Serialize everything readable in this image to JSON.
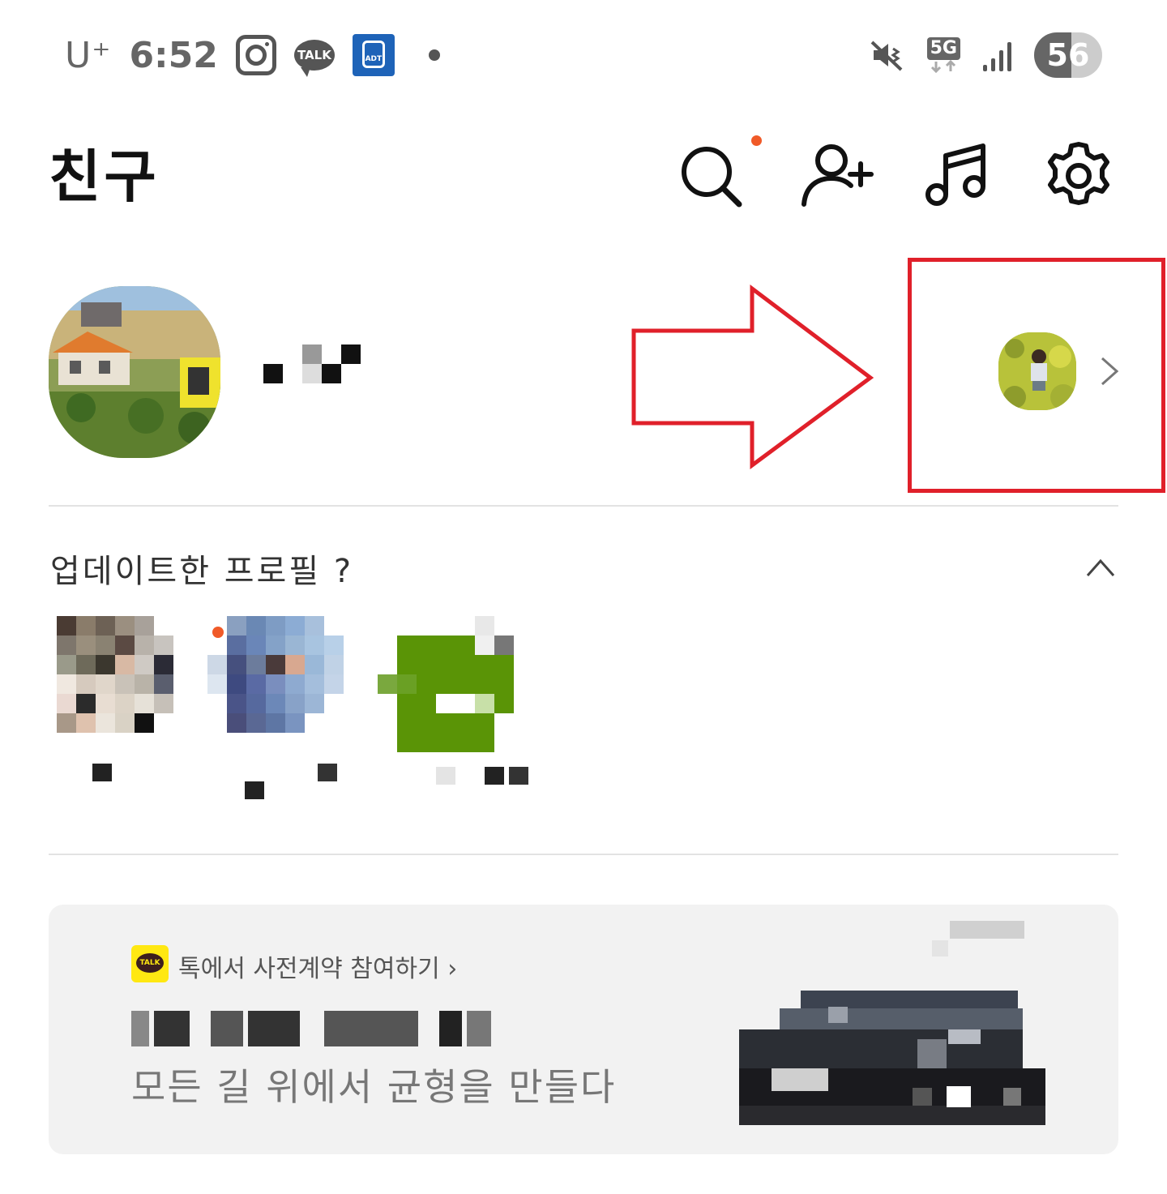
{
  "status_bar": {
    "carrier": "U⁺",
    "time": "6:52",
    "icons_left": [
      "instagram-icon",
      "kakaotalk-icon",
      "adt-icon",
      "notification-dot"
    ],
    "talk_label": "TALK",
    "adt_label": "ADT",
    "icons_right": [
      "mute-vibrate-icon",
      "5g-icon",
      "signal-icon",
      "battery-icon"
    ],
    "network": "5G",
    "battery": "56"
  },
  "header": {
    "title": "친구",
    "actions": [
      "search-icon",
      "add-friend-icon",
      "music-icon",
      "settings-icon"
    ],
    "search_badge_color": "#f05a28"
  },
  "my_profile": {
    "name_obscured": true
  },
  "annotation": {
    "arrow_color": "#e0202a",
    "box_color": "#e0202a"
  },
  "updated_profiles": {
    "title": "업데이트한 프로필 ?",
    "friends_count_visible": 3
  },
  "ad": {
    "brand_badge": "TALK",
    "link_text": "톡에서 사전계약 참여하기 ›",
    "slogan": "모든 길 위에서 균형을 만들다"
  }
}
